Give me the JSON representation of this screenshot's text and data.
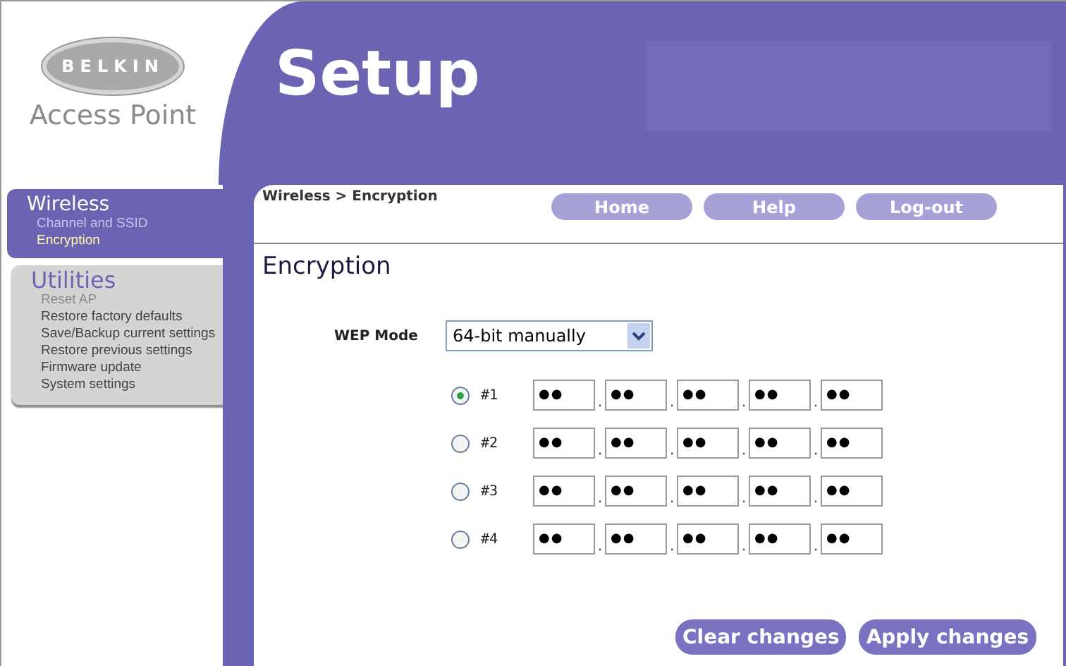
{
  "logo": {
    "brand": "BELKIN",
    "product": "Access Point"
  },
  "header": {
    "title": "Setup"
  },
  "sidebar": [
    {
      "title": "Wireless",
      "selected": true,
      "items": [
        {
          "label": "Channel and SSID",
          "selected": false
        },
        {
          "label": "Encryption",
          "selected": true
        }
      ]
    },
    {
      "title": "Utilities",
      "selected": false,
      "items": [
        {
          "label": "Reset AP",
          "disabled": true
        },
        {
          "label": "Restore factory defaults",
          "disabled": false
        },
        {
          "label": "Save/Backup current settings",
          "disabled": false
        },
        {
          "label": "Restore previous settings",
          "disabled": false
        },
        {
          "label": "Firmware update",
          "disabled": false
        },
        {
          "label": "System settings",
          "disabled": false
        }
      ]
    }
  ],
  "breadcrumb": "Wireless > Encryption",
  "nav_buttons": [
    "Home",
    "Help",
    "Log-out"
  ],
  "page_title": "Encryption",
  "wep_mode": {
    "label": "WEP Mode",
    "value": "64-bit manually"
  },
  "keys": [
    {
      "label": "#1",
      "selected": true,
      "fields": [
        "●●",
        "●●",
        "●●",
        "●●",
        "●●"
      ],
      "separators": [
        ".",
        ".",
        ".",
        "."
      ]
    },
    {
      "label": "#2",
      "selected": false,
      "fields": [
        "●●",
        "●●",
        "●●",
        "●●",
        "●●"
      ],
      "separators": [
        ".",
        ".",
        ".",
        "."
      ]
    },
    {
      "label": "#3",
      "selected": false,
      "fields": [
        "●●",
        "●●",
        "●●",
        "●●",
        "●●"
      ],
      "separators": [
        ".",
        ".",
        ".",
        "."
      ]
    },
    {
      "label": "#4",
      "selected": false,
      "fields": [
        "●●",
        "●●",
        "●●",
        "●●",
        "●●"
      ],
      "separators": [
        ".",
        ".",
        ".",
        "."
      ]
    }
  ],
  "actions": [
    "Clear changes",
    "Apply changes"
  ]
}
